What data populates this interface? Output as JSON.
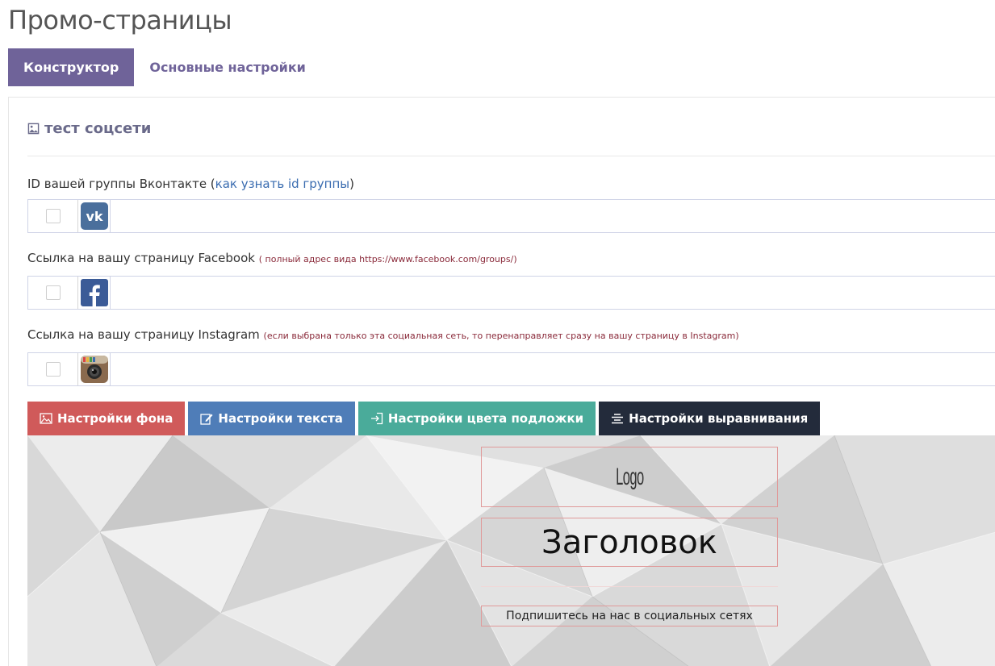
{
  "page": {
    "title": "Промо-страницы"
  },
  "tabs": [
    {
      "label": "Конструктор",
      "active": true
    },
    {
      "label": "Основные настройки",
      "active": false
    }
  ],
  "section": {
    "title": "тест соцсети",
    "icon": "image-icon"
  },
  "fields": {
    "vk": {
      "label": "ID вашей группы Вконтакте (",
      "link": "как узнать id группы",
      "label_end": ")",
      "value": "",
      "icon": "vk-icon",
      "checked": false
    },
    "facebook": {
      "label": "Ссылка на вашу страницу Facebook",
      "hint": "( полный адрес вида https://www.facebook.com/groups/)",
      "value": "",
      "icon": "facebook-icon",
      "checked": false
    },
    "instagram": {
      "label": "Ссылка на вашу страницу Instagram",
      "hint": "(если выбрана только эта социальная сеть, то перенаправляет сразу на вашу страницу в Instagram)",
      "value": "",
      "icon": "instagram-icon",
      "checked": false
    }
  },
  "toolbar": {
    "background": {
      "label": "Настройки фона",
      "color": "#d05a5a",
      "icon": "image-icon"
    },
    "text": {
      "label": "Настройки текста",
      "color": "#4f7db8",
      "icon": "edit-icon"
    },
    "overlay": {
      "label": "Настройки цвета подложки",
      "color": "#4aab9a",
      "icon": "sign-in-icon"
    },
    "align": {
      "label": "Настройки выравнивания",
      "color": "#232b3b",
      "icon": "align-center-icon"
    }
  },
  "preview": {
    "logo": "Logo",
    "heading": "Заголовок",
    "subscribe": "Подпишитесь на нас в социальных сетях"
  }
}
